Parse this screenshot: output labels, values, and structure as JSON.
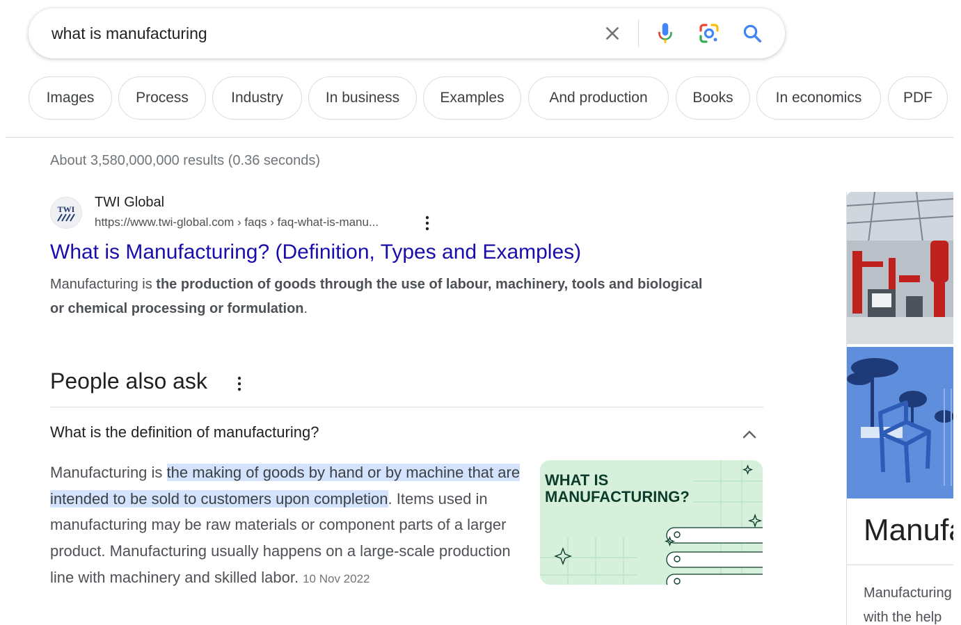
{
  "search": {
    "query": "what is manufacturing",
    "icons": [
      "close-icon",
      "microphone-icon",
      "google-lens-icon",
      "search-icon"
    ]
  },
  "chips": [
    "Images",
    "Process",
    "Industry",
    "In business",
    "Examples",
    "And production",
    "Books",
    "In economics",
    "PDF"
  ],
  "stats": "About 3,580,000,000 results (0.36 seconds)",
  "result": {
    "site_name": "TWI Global",
    "favicon_text": "TWI",
    "url": "https://www.twi-global.com › faqs › faq-what-is-manu...",
    "title": "What is Manufacturing? (Definition, Types and Examples)",
    "snippet_plain": "Manufacturing is ",
    "snippet_bold": "the production of goods through the use of labour, machinery, tools and biological or chemical processing or formulation",
    "snippet_end": "."
  },
  "paa": {
    "title": "People also ask",
    "question": "What is the definition of manufacturing?",
    "answer_prefix": "Manufacturing is ",
    "answer_highlight": "the making of goods by hand or by machine that are intended to be sold to customers upon completion",
    "answer_rest": ". Items used in manufacturing may be raw materials or component parts of a larger product. Manufacturing usually happens on a large-scale production line with machinery and skilled labor.",
    "date": "10 Nov 2022",
    "thumb_text": "WHAT IS MANUFACTURING?"
  },
  "knowledge_panel": {
    "title": "Manufacturing",
    "desc_line1": "Manufacturing",
    "desc_line2": "with the help"
  },
  "colors": {
    "link": "#1a0dab",
    "highlight": "#d3e3fd",
    "thumb_bg": "#d6f0dc",
    "thumb_text": "#0b3b2a"
  }
}
